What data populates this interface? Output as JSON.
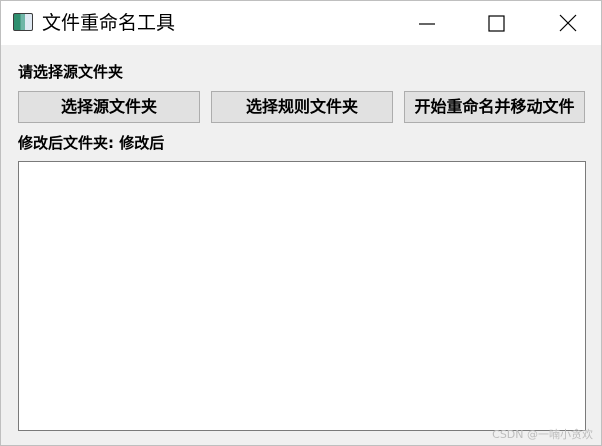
{
  "window": {
    "title": "文件重命名工具"
  },
  "labels": {
    "source_prompt": "请选择源文件夹",
    "dest_label": "修改后文件夹: 修改后"
  },
  "buttons": {
    "select_source": "选择源文件夹",
    "select_rules": "选择规则文件夹",
    "start": "开始重命名并移动文件"
  },
  "output": {
    "text": ""
  },
  "watermark": "CSDN @一喃小贪欢",
  "icons": {
    "app": "app-window-icon",
    "minimize": "minimize-icon",
    "maximize": "maximize-icon",
    "close": "close-icon"
  }
}
